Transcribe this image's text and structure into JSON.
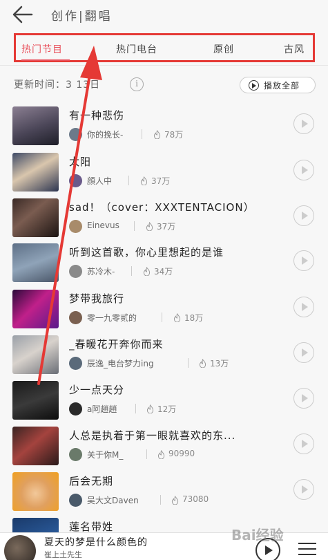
{
  "header": {
    "title": "创作|翻唱"
  },
  "tabs": [
    {
      "label": "热门节目",
      "active": true
    },
    {
      "label": "热门电台",
      "active": false
    },
    {
      "label": "原创",
      "active": false
    },
    {
      "label": "古风",
      "active": false
    }
  ],
  "toolbar": {
    "update_time": "更新时间：3 13日",
    "play_all": "播放全部"
  },
  "songs": [
    {
      "title": "有一种悲伤",
      "artist": "你的挽长-",
      "plays": "78万"
    },
    {
      "title": "太阳",
      "artist": "顔人中",
      "plays": "37万"
    },
    {
      "title": "sad！（cover：XXXTENTACION）",
      "artist": "Einevus",
      "plays": "37万"
    },
    {
      "title": "听到这首歌，你心里想起的是谁",
      "artist": "苏冷木-",
      "plays": "34万"
    },
    {
      "title": "梦带我旅行",
      "artist": "零一九零贰的",
      "plays": "18万"
    },
    {
      "title": "_春暖花开奔你而来",
      "artist": "辰逸_电台梦力ing",
      "plays": "13万"
    },
    {
      "title": "少一点天分",
      "artist": "a阿趙趙",
      "plays": "12万"
    },
    {
      "title": "人总是执着于第一眼就喜欢的东...",
      "artist": "关于你M_",
      "plays": "90990"
    },
    {
      "title": "后会无期",
      "artist": "吴大文Daven",
      "plays": "73080"
    },
    {
      "title": "莲名带姓",
      "artist": "",
      "plays": ""
    }
  ],
  "now_playing": {
    "title": "夏天的梦是什么颜色的",
    "artist": "崔上土先生"
  },
  "watermark": "Bai经验",
  "colors": {
    "accent": "#e8505b",
    "annotation": "#e53935"
  }
}
